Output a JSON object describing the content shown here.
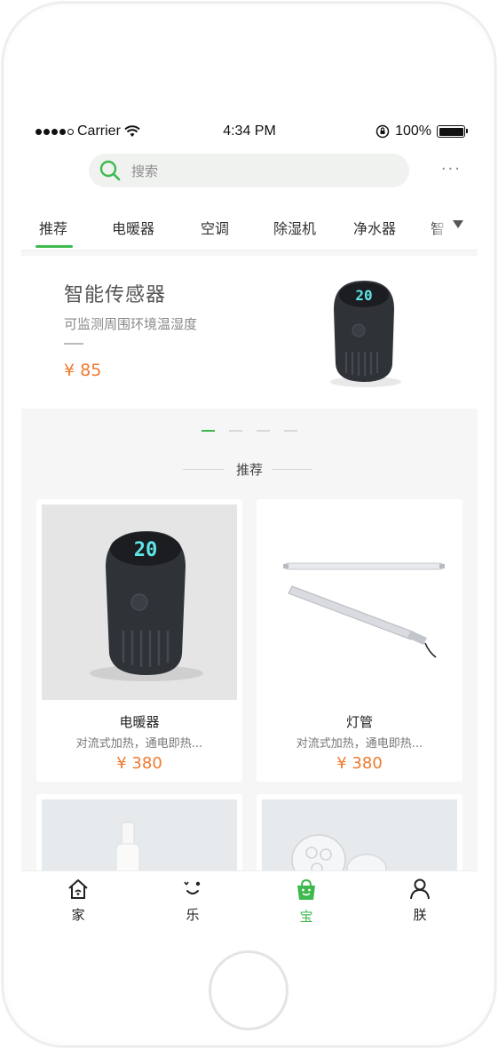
{
  "status_bar": {
    "carrier": "Carrier",
    "time": "4:34 PM",
    "battery": "100%"
  },
  "search": {
    "placeholder": "搜索"
  },
  "header": {
    "more": "···"
  },
  "tabs": [
    {
      "label": "推荐",
      "active": true
    },
    {
      "label": "电暖器"
    },
    {
      "label": "空调"
    },
    {
      "label": "除湿机"
    },
    {
      "label": "净水器"
    },
    {
      "label": "智"
    }
  ],
  "banner": {
    "title": "智能传感器",
    "subtitle": "可监测周围环境温湿度",
    "price": "¥ 85",
    "device_display": "20"
  },
  "pager": {
    "count": 4,
    "active": 0
  },
  "section": {
    "title": "推荐"
  },
  "products": [
    {
      "name": "电暖器",
      "desc": "对流式加热，通电即热...",
      "price": "¥ 380",
      "display": "20"
    },
    {
      "name": "灯管",
      "desc": "对流式加热，通电即热...",
      "price": "¥ 380"
    }
  ],
  "nav": [
    {
      "label": "家",
      "icon": "home-icon"
    },
    {
      "label": "乐",
      "icon": "fun-icon"
    },
    {
      "label": "宝",
      "icon": "shopping-bag-icon",
      "active": true
    },
    {
      "label": "朕",
      "icon": "user-icon"
    }
  ],
  "colors": {
    "accent": "#3db94e",
    "price": "#ee7a2e"
  }
}
